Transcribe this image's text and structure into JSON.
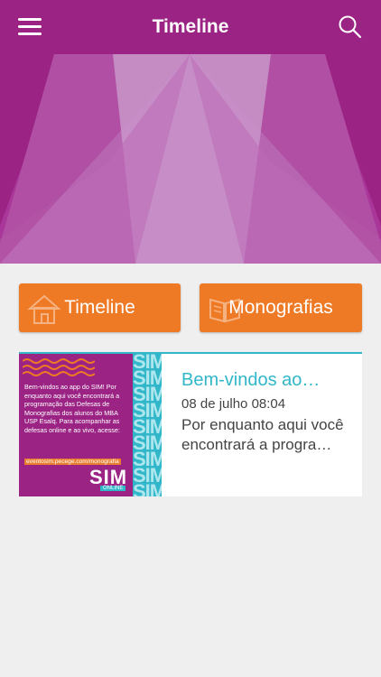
{
  "header": {
    "title": "Timeline",
    "menu_icon": "hamburger-menu-icon",
    "search_icon": "search-icon"
  },
  "nav_buttons": [
    {
      "label": "Timeline",
      "icon": "house-icon"
    },
    {
      "label": "Monografias",
      "icon": "open-book-icon"
    }
  ],
  "feed": [
    {
      "title": "Bem-vindos ao…",
      "date": "08 de julho 08:04",
      "excerpt": "Por enquanto aqui você encontrará a progra…",
      "thumbnail": {
        "text": "Bem-vindos ao app do SIM! Por enquanto aqui você encontrará a programação das Defesas de Monografias dos alunos do MBA USP Esalq. Para acompanhar as defesas online e ao vivo, acesse:",
        "url": "eventosim.pecege.com/monografia",
        "logo": "SIM",
        "logo_sub": "ONLINE",
        "stripe_text": "SIM"
      }
    }
  ],
  "colors": {
    "brand_purple": "#9a2384",
    "accent_orange": "#ef7a26",
    "accent_teal": "#31b7c9",
    "background": "#efeff0"
  }
}
